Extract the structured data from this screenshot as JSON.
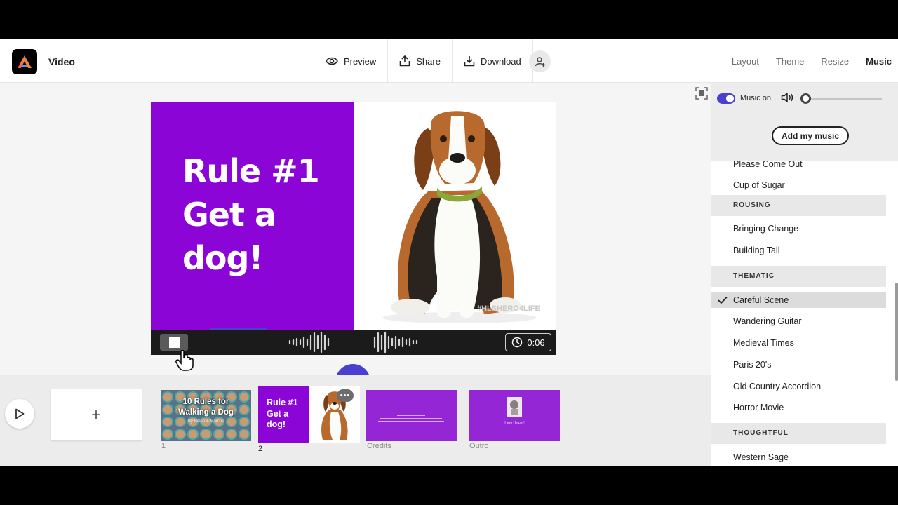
{
  "header": {
    "app_title": "Video",
    "toolbar": {
      "preview": "Preview",
      "share": "Share",
      "download": "Download"
    },
    "right_tabs": [
      "Layout",
      "Theme",
      "Resize",
      "Music"
    ],
    "active_tab": "Music"
  },
  "slide": {
    "line1": "Rule #1",
    "line2": "Get a",
    "line3": "dog!",
    "hashtag": "#HLSHERO4LIFE",
    "background": "#8a05d6"
  },
  "recorder": {
    "duration": "0:06",
    "accent": "#4a40d0"
  },
  "timeline": {
    "add_symbol": "+",
    "scenes": [
      {
        "label": "1",
        "title_line1": "10 Rules for",
        "title_line2": "Walking a Dog",
        "subtitle": "By Helen & Marcus"
      },
      {
        "label": "2",
        "line1": "Rule #1",
        "line2": "Get a",
        "line3": "dog!",
        "more": "•••"
      },
      {
        "label": "Credits"
      },
      {
        "label": "Outro",
        "caption": "Hero Helper!"
      }
    ]
  },
  "music": {
    "toggle_label": "Music on",
    "toggle_on": true,
    "volume": 0,
    "add_button": "Add my music",
    "tracks": [
      {
        "type": "item",
        "name": "Please Come Out"
      },
      {
        "type": "item",
        "name": "Cup of Sugar"
      },
      {
        "type": "header",
        "name": "ROUSING"
      },
      {
        "type": "item",
        "name": "Bringing Change"
      },
      {
        "type": "item",
        "name": "Building Tall"
      },
      {
        "type": "header",
        "name": "THEMATIC"
      },
      {
        "type": "item",
        "name": "Careful Scene",
        "selected": true
      },
      {
        "type": "item",
        "name": "Wandering Guitar"
      },
      {
        "type": "item",
        "name": "Medieval Times"
      },
      {
        "type": "item",
        "name": "Paris 20's"
      },
      {
        "type": "item",
        "name": "Old Country Accordion"
      },
      {
        "type": "item",
        "name": "Horror Movie"
      },
      {
        "type": "header",
        "name": "THOUGHTFUL"
      },
      {
        "type": "item",
        "name": "Western Sage"
      }
    ]
  }
}
